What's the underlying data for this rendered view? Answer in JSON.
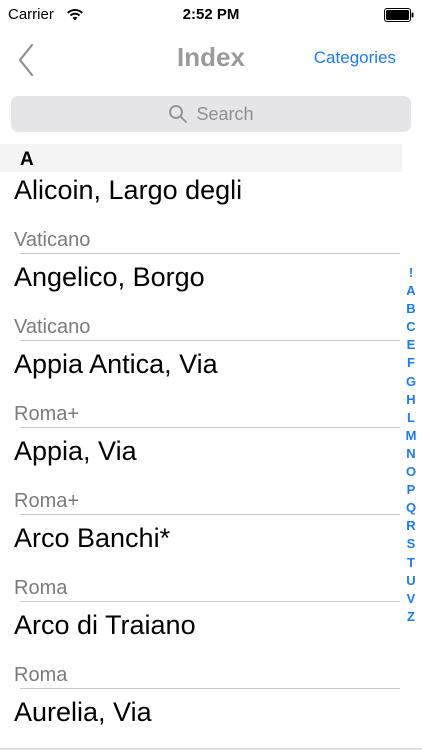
{
  "status_bar": {
    "carrier": "Carrier",
    "time": "2:52 PM"
  },
  "nav": {
    "title": "Index",
    "right_button": "Categories"
  },
  "search": {
    "placeholder": "Search"
  },
  "section": {
    "letter": "A"
  },
  "rows": [
    {
      "title": "Alicoin, Largo degli",
      "subtitle": "Vaticano"
    },
    {
      "title": "Angelico, Borgo",
      "subtitle": "Vaticano"
    },
    {
      "title": "Appia Antica, Via",
      "subtitle": "Roma+"
    },
    {
      "title": "Appia, Via",
      "subtitle": "Roma+"
    },
    {
      "title": "Arco Banchi*",
      "subtitle": "Roma"
    },
    {
      "title": "Arco di Traiano",
      "subtitle": "Roma"
    },
    {
      "title": "Aurelia, Via",
      "subtitle": ""
    }
  ],
  "index_letters": [
    "!",
    "A",
    "B",
    "C",
    "E",
    "F",
    "G",
    "H",
    "L",
    "M",
    "N",
    "O",
    "P",
    "Q",
    "R",
    "S",
    "T",
    "U",
    "V",
    "Z"
  ],
  "colors": {
    "accent": "#1a7cf4",
    "title_gray": "#9a9a9a",
    "subtitle_gray": "#7b7b7b"
  }
}
